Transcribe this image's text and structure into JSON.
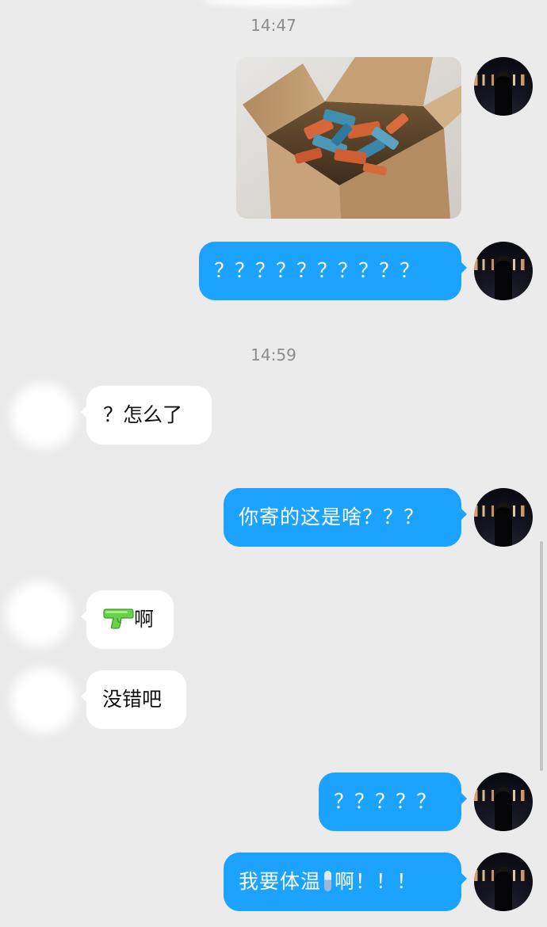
{
  "chat": {
    "timestamp_1": "14:47",
    "timestamp_2": "14:59",
    "messages": [
      {
        "sender": "self",
        "type": "image",
        "image_desc": "cardboard-box-with-water-guns"
      },
      {
        "sender": "self",
        "type": "text",
        "text": "？？？？？？？？？？"
      },
      {
        "sender": "other",
        "type": "text",
        "text": "？怎么了"
      },
      {
        "sender": "self",
        "type": "text",
        "text": "你寄的这是啥？？？"
      },
      {
        "sender": "other",
        "type": "text",
        "emoji": "water-pistol",
        "text": "啊"
      },
      {
        "sender": "other",
        "type": "text",
        "text": "没错吧"
      },
      {
        "sender": "self",
        "type": "text",
        "text": "？？？？？"
      },
      {
        "sender": "self",
        "type": "text",
        "text_before": "我要体温",
        "emoji": "thermometer",
        "text_after": "啊！！！"
      }
    ]
  },
  "colors": {
    "background": "#ebebeb",
    "outgoing_bubble": "#1ba3ff",
    "incoming_bubble": "#ffffff",
    "timestamp_text": "#8c8c8c"
  }
}
